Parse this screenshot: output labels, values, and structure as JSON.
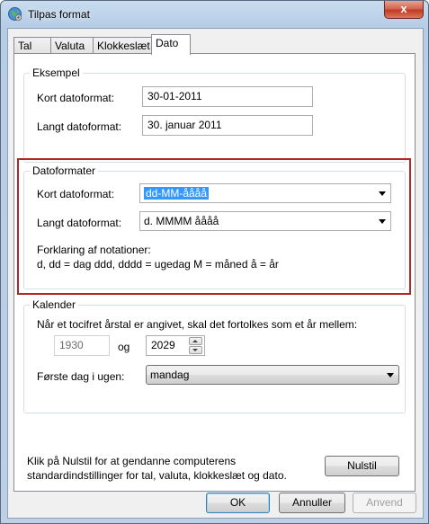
{
  "window": {
    "title": "Tilpas format",
    "close_glyph": "x"
  },
  "tabs": [
    {
      "label": "Tal"
    },
    {
      "label": "Valuta"
    },
    {
      "label": "Klokkeslæt"
    },
    {
      "label": "Dato"
    }
  ],
  "example": {
    "legend": "Eksempel",
    "short_label": "Kort datoformat:",
    "short_value": "30-01-2011",
    "long_label": "Langt datoformat:",
    "long_value": "30. januar 2011"
  },
  "formats": {
    "legend": "Datoformater",
    "short_label": "Kort datoformat:",
    "short_value": "dd-MM-åååå",
    "long_label": "Langt datoformat:",
    "long_value": "d. MMMM åååå",
    "notation_title": "Forklaring af notationer:",
    "notation_text": "d, dd = dag  ddd, dddd = ugedag  M = måned  å = år",
    "highlight_color": "#b0262a"
  },
  "calendar": {
    "legend": "Kalender",
    "two_digit_text": "Når et tocifret årstal er angivet, skal det fortolkes som et år mellem:",
    "year_from": "1930",
    "and_label": "og",
    "year_to": "2029",
    "first_day_label": "Første dag i ugen:",
    "first_day_value": "mandag"
  },
  "reset": {
    "text_line1": "Klik på Nulstil for at gendanne computerens",
    "text_line2": "standardindstillinger for tal, valuta, klokkeslæt og dato.",
    "button": "Nulstil"
  },
  "buttons": {
    "ok": "OK",
    "cancel": "Annuller",
    "apply": "Anvend"
  }
}
